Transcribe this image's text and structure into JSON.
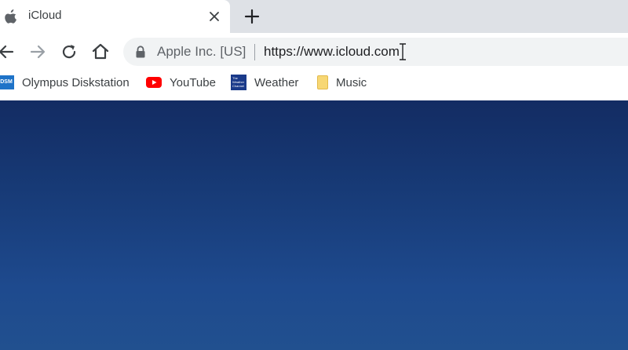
{
  "tab": {
    "title": "iCloud",
    "favicon": "apple-icon",
    "close_icon": "close-icon"
  },
  "toolbar": {
    "back_icon": "back-arrow-icon",
    "forward_icon": "forward-arrow-icon",
    "reload_icon": "reload-icon",
    "home_icon": "home-icon",
    "new_tab_icon": "plus-icon"
  },
  "address_bar": {
    "security_icon": "lock-icon",
    "organization": "Apple Inc. [US]",
    "url": "https://www.icloud.com"
  },
  "bookmarks": [
    {
      "label": "Olympus Diskstation",
      "icon": "dsm-icon",
      "icon_text": "DSM"
    },
    {
      "label": "YouTube",
      "icon": "youtube-icon"
    },
    {
      "label": "Weather",
      "icon": "weather-icon",
      "icon_text": "The Weather Channel"
    },
    {
      "label": "Music",
      "icon": "folder-icon"
    }
  ],
  "colors": {
    "content_background_top": "#132c63",
    "content_background_bottom": "#21508f",
    "youtube_red": "#ff0000",
    "tab_strip": "#dee1e6"
  }
}
